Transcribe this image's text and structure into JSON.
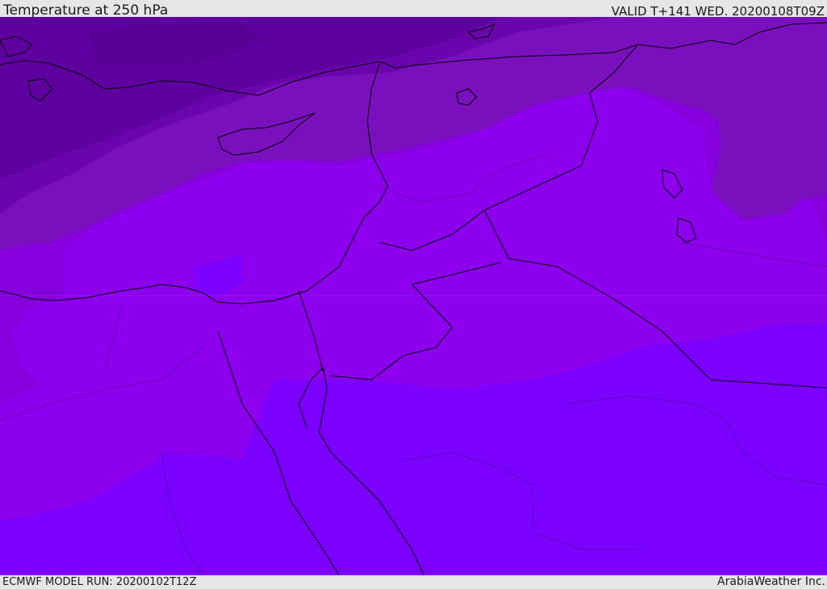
{
  "header": {
    "title": "Temperature at 250 hPa",
    "valid": "VALID T+141 WED. 20200108T09Z"
  },
  "footer": {
    "model_run": "ECMWF MODEL RUN: 20200102T12Z",
    "credit": "ArabiaWeather Inc."
  },
  "map": {
    "field": "temperature",
    "level": "250 hPa",
    "colors": {
      "band_1_darkest": "#5e00a0",
      "band_2": "#6a04ac",
      "band_3": "#7a10bd",
      "band_4": "#8500dc",
      "band_5": "#8c00ee",
      "band_6_brightest": "#7b00ff",
      "coastline": "#000000"
    }
  }
}
